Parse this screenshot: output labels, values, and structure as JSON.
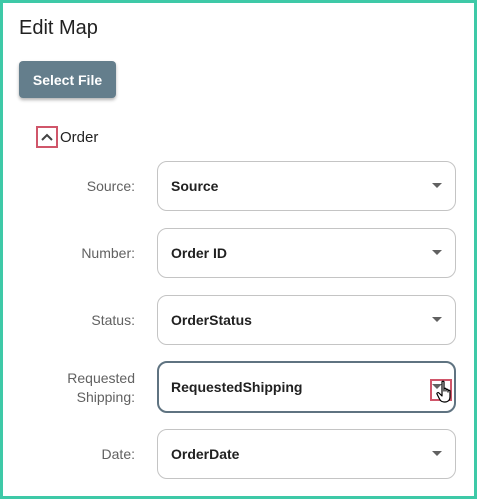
{
  "page": {
    "title": "Edit Map"
  },
  "actions": {
    "select_file_label": "Select File"
  },
  "section": {
    "label": "Order",
    "toggle_icon": "chevron-up-icon",
    "expanded": true
  },
  "fields": [
    {
      "label": "Source:",
      "value": "Source"
    },
    {
      "label": "Number:",
      "value": "Order ID"
    },
    {
      "label": "Status:",
      "value": "OrderStatus"
    },
    {
      "label": "Requested Shipping:",
      "value": "RequestedShipping",
      "focused": true
    },
    {
      "label": "Date:",
      "value": "OrderDate"
    }
  ],
  "colors": {
    "frame_border": "#3ec9a7",
    "button_bg": "#647e8c",
    "highlight": "#d0566a",
    "focused_border": "#5f7381"
  }
}
